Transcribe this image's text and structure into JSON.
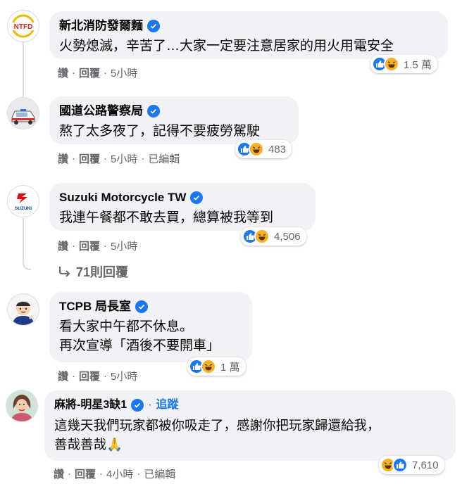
{
  "comments": [
    {
      "name": "新北消防發爾麵",
      "text": [
        "火勢熄滅，辛苦了…大家一定要注意居家的用火用電安全"
      ],
      "like_label": "讚",
      "reply_label": "回覆",
      "time": "5小時",
      "reaction_count": "1.5 萬"
    },
    {
      "name": "國道公路警察局",
      "text": [
        "熬了太多夜了，記得不要疲勞駕駛"
      ],
      "like_label": "讚",
      "reply_label": "回覆",
      "time": "5小時",
      "edited": "已編輯",
      "reaction_count": "483"
    },
    {
      "name": "Suzuki Motorcycle TW",
      "text": [
        "我連午餐都不敢去買，總算被我等到"
      ],
      "like_label": "讚",
      "reply_label": "回覆",
      "time": "5小時",
      "reaction_count": "4,506",
      "replies_link": "71則回覆"
    },
    {
      "name": "TCPB 局長室",
      "text": [
        "看大家中午都不休息。",
        "再次宣導「酒後不要開車」"
      ],
      "like_label": "讚",
      "reply_label": "回覆",
      "time": "5小時",
      "reaction_count": "1 萬"
    },
    {
      "name": "麻將-明星3缺1",
      "follow_label": "追蹤",
      "text": [
        "這幾天我們玩家都被你吸走了，感謝你把玩家歸還給我，",
        "善哉善哉🙏"
      ],
      "like_label": "讚",
      "reply_label": "回覆",
      "time": "4小時",
      "edited": "已編輯",
      "reaction_count": "7,610"
    }
  ],
  "avatars": {
    "c0_badge_text": "NTFD",
    "c2_logo_text": "SUZUKI"
  },
  "colors": {
    "bubble_bg": "#f0f2f5",
    "verified_blue": "#1877f2",
    "meta_gray": "#65676b",
    "haha_yellow": "#f7b125"
  },
  "icons": [
    "verified-badge-icon",
    "like-reaction-icon",
    "haha-reaction-icon",
    "reply-arrow-icon",
    "folded-hands-emoji"
  ]
}
